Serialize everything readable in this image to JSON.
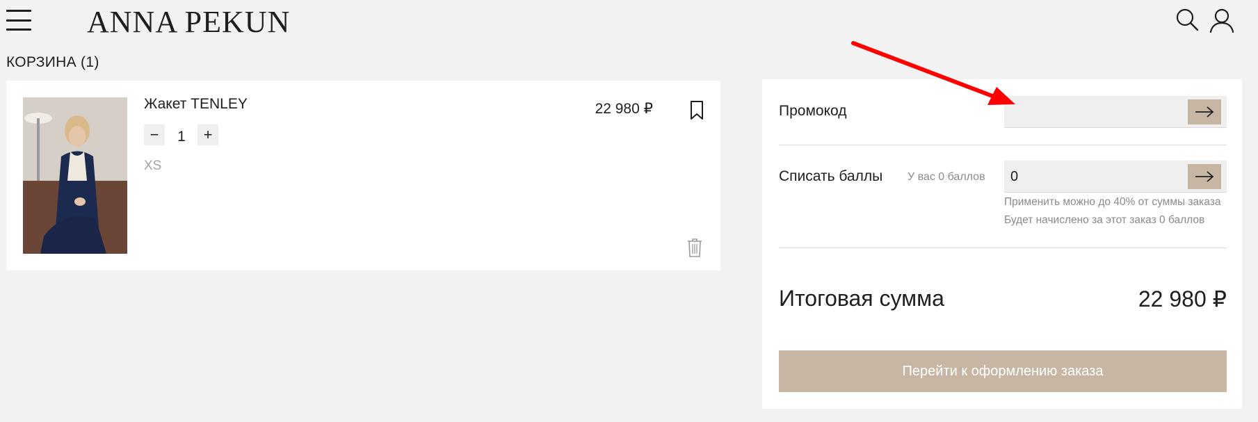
{
  "header": {
    "logo": "ANNA PEKUN",
    "icons": [
      "menu-icon",
      "search-icon",
      "user-icon"
    ]
  },
  "cart": {
    "title": "КОРЗИНА (1)",
    "items": [
      {
        "name": "Жакет TENLEY",
        "quantity": "1",
        "minus_label": "−",
        "plus_label": "+",
        "size": "XS",
        "price": "22 980 ₽",
        "icons": [
          "bookmark-icon",
          "trash-icon"
        ]
      }
    ]
  },
  "summary": {
    "promo_label": "Промокод",
    "promo_value": "",
    "points_label": "Списать баллы",
    "points_balance": "У вас 0 баллов",
    "points_value": "0",
    "hint_max": "Применить можно до 40% от суммы заказа",
    "hint_accrual": "Будет начислено за этот заказ 0 баллов",
    "total_label": "Итоговая сумма",
    "total_value": "22 980 ₽",
    "checkout_label": "Перейти к оформлению заказа"
  },
  "colors": {
    "background": "#f2f2f2",
    "accent": "#c6b6a3",
    "annotation": "#ff0000"
  }
}
